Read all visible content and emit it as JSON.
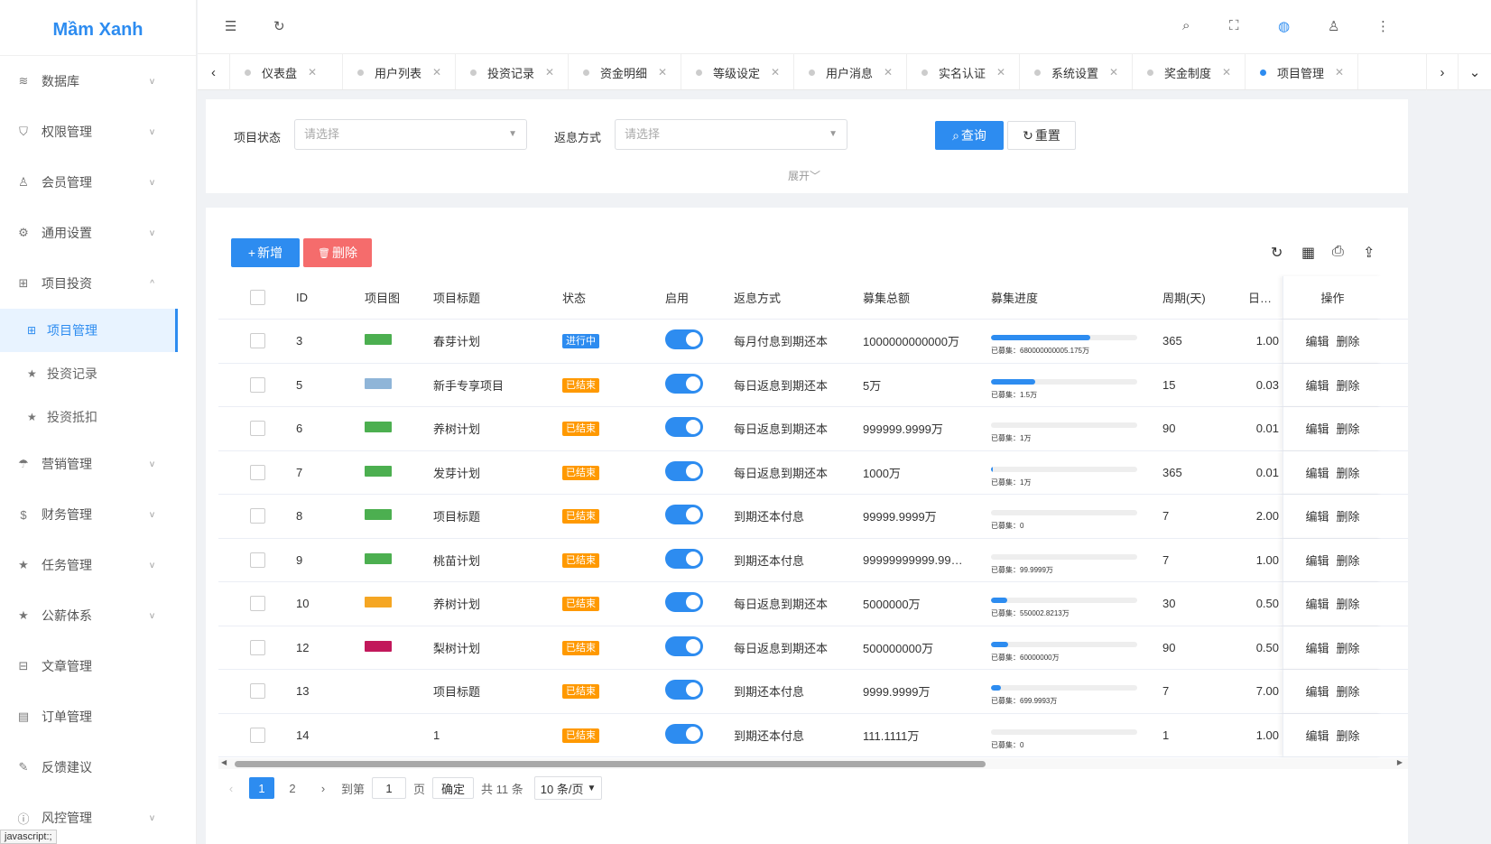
{
  "app": {
    "logo": "Mầm Xanh"
  },
  "sidebar": {
    "items": [
      {
        "label": "数据库",
        "icon": "layers-icon",
        "glyph": "≋",
        "chevron": "﹀"
      },
      {
        "label": "权限管理",
        "icon": "shield-icon",
        "glyph": "⛉",
        "chevron": "﹀"
      },
      {
        "label": "会员管理",
        "icon": "user-icon",
        "glyph": "♙",
        "chevron": "﹀"
      },
      {
        "label": "通用设置",
        "icon": "gear-icon",
        "glyph": "⚙",
        "chevron": "﹀"
      },
      {
        "label": "项目投资",
        "icon": "apps-icon",
        "glyph": "⊞",
        "chevron": "︿"
      },
      {
        "label": "营销管理",
        "icon": "umbrella-icon",
        "glyph": "☂",
        "chevron": "﹀"
      },
      {
        "label": "财务管理",
        "icon": "dollar-icon",
        "glyph": "$",
        "chevron": "﹀"
      },
      {
        "label": "任务管理",
        "icon": "star-icon",
        "glyph": "★",
        "chevron": "﹀"
      },
      {
        "label": "公薪体系",
        "icon": "star-icon",
        "glyph": "★",
        "chevron": "﹀"
      },
      {
        "label": "文章管理",
        "icon": "book-icon",
        "glyph": "⊟",
        "chevron": ""
      },
      {
        "label": "订单管理",
        "icon": "calendar-icon",
        "glyph": "▤",
        "chevron": ""
      },
      {
        "label": "反馈建议",
        "icon": "edit-icon",
        "glyph": "✎",
        "chevron": ""
      },
      {
        "label": "风控管理",
        "icon": "info-icon",
        "glyph": "ⓘ",
        "chevron": "﹀"
      }
    ],
    "sub_items": [
      {
        "label": "项目管理",
        "icon": "apps-icon",
        "glyph": "⊞"
      },
      {
        "label": "投资记录",
        "icon": "star-icon",
        "glyph": "★"
      },
      {
        "label": "投资抵扣",
        "icon": "star-icon",
        "glyph": "★"
      }
    ],
    "status_text": "javascript:;"
  },
  "topbar": {
    "icons": [
      "menu-fold-icon",
      "refresh-icon",
      "search-icon",
      "fullscreen-icon",
      "globe-icon",
      "user-icon",
      "more-icon"
    ]
  },
  "tabs": [
    "仪表盘",
    "用户列表",
    "投资记录",
    "资金明细",
    "等级设定",
    "用户消息",
    "实名认证",
    "系统设置",
    "奖金制度",
    "项目管理"
  ],
  "active_tab": "项目管理",
  "search": {
    "status_label": "项目状态",
    "status_placeholder": "请选择",
    "mode_label": "返息方式",
    "mode_placeholder": "请选择",
    "query_label": "查询",
    "reset_label": "重置",
    "expand_label": "展开"
  },
  "toolbar": {
    "add_label": "新增",
    "delete_label": "删除"
  },
  "table": {
    "headers": [
      "ID",
      "项目图",
      "项目标题",
      "状态",
      "启用",
      "返息方式",
      "募集总额",
      "募集进度",
      "周期(天)",
      "日利率",
      "操作"
    ],
    "raised_prefix": "已募集：",
    "edit_label": "编辑",
    "delete_label": "删除",
    "rows": [
      {
        "id": "3",
        "title": "春芽计划",
        "status": "进行中",
        "status_color": "#2d8cf0",
        "thumb": "#4caf50",
        "mode": "每月付息到期还本",
        "total": "1000000000000万",
        "progress": 0.68,
        "raised": "680000000005.175万",
        "cycle": "365",
        "rate": "1.00"
      },
      {
        "id": "5",
        "title": "新手专享项目",
        "status": "已结束",
        "status_color": "#ff9900",
        "thumb": "#8fb5d8",
        "mode": "每日返息到期还本",
        "total": "5万",
        "progress": 0.3,
        "raised": "1.5万",
        "cycle": "15",
        "rate": "0.03"
      },
      {
        "id": "6",
        "title": "养树计划",
        "status": "已结束",
        "status_color": "#ff9900",
        "thumb": "#4caf50",
        "mode": "每日返息到期还本",
        "total": "999999.9999万",
        "progress": 0.0,
        "raised": "1万",
        "cycle": "90",
        "rate": "0.01"
      },
      {
        "id": "7",
        "title": "发芽计划",
        "status": "已结束",
        "status_color": "#ff9900",
        "thumb": "#4caf50",
        "mode": "每日返息到期还本",
        "total": "1000万",
        "progress": 0.01,
        "raised": "1万",
        "cycle": "365",
        "rate": "0.01"
      },
      {
        "id": "8",
        "title": "项目标题",
        "status": "已结束",
        "status_color": "#ff9900",
        "thumb": "#4caf50",
        "mode": "到期还本付息",
        "total": "99999.9999万",
        "progress": 0.0,
        "raised": "0",
        "cycle": "7",
        "rate": "2.00"
      },
      {
        "id": "9",
        "title": "桃苗计划",
        "status": "已结束",
        "status_color": "#ff9900",
        "thumb": "#4caf50",
        "mode": "到期还本付息",
        "total": "99999999999.99…",
        "progress": 0.0,
        "raised": "99.9999万",
        "cycle": "7",
        "rate": "1.00"
      },
      {
        "id": "10",
        "title": "养树计划",
        "status": "已结束",
        "status_color": "#ff9900",
        "thumb": "#f5a623",
        "mode": "每日返息到期还本",
        "total": "5000000万",
        "progress": 0.11,
        "raised": "550002.8213万",
        "cycle": "30",
        "rate": "0.50"
      },
      {
        "id": "12",
        "title": "梨树计划",
        "status": "已结束",
        "status_color": "#ff9900",
        "thumb": "#c2185b",
        "mode": "每日返息到期还本",
        "total": "500000000万",
        "progress": 0.12,
        "raised": "60000000万",
        "cycle": "90",
        "rate": "0.50"
      },
      {
        "id": "13",
        "title": "项目标题",
        "status": "已结束",
        "status_color": "#ff9900",
        "thumb": "",
        "mode": "到期还本付息",
        "total": "9999.9999万",
        "progress": 0.07,
        "raised": "699.9993万",
        "cycle": "7",
        "rate": "7.00"
      },
      {
        "id": "14",
        "title": "1",
        "status": "已结束",
        "status_color": "#ff9900",
        "thumb": "",
        "mode": "到期还本付息",
        "total": "111.1111万",
        "progress": 0.0,
        "raised": "0",
        "cycle": "1",
        "rate": "1.00"
      }
    ]
  },
  "pagination": {
    "pages": [
      "1",
      "2"
    ],
    "goto_label": "到第",
    "goto_value": "1",
    "page_unit": "页",
    "confirm_label": "确定",
    "total_text": "共 11 条",
    "page_size": "10 条/页"
  }
}
